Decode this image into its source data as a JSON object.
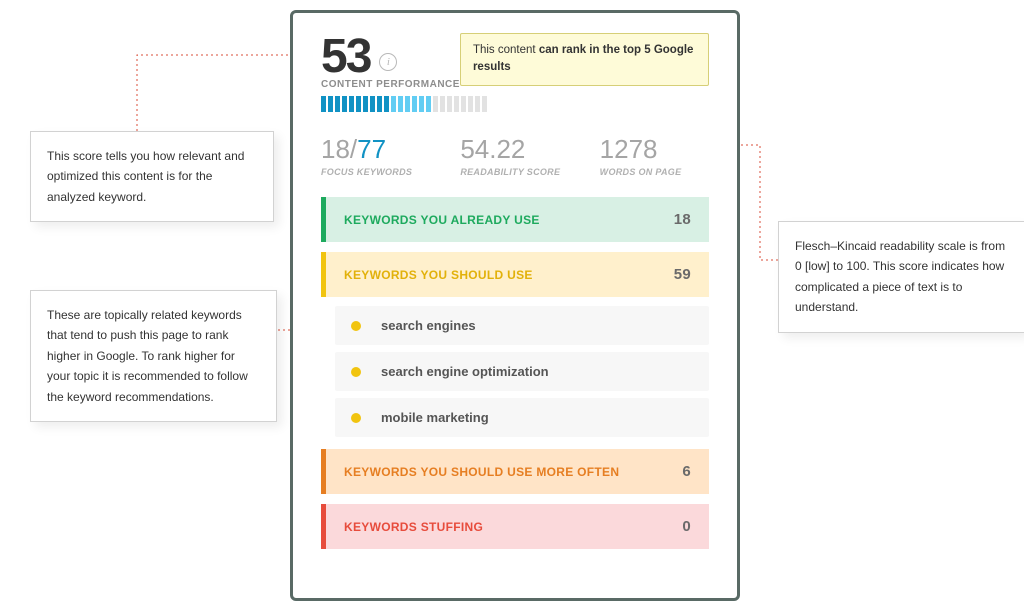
{
  "score": {
    "value": "53",
    "label": "CONTENT PERFORMANCE"
  },
  "rank_tooltip": {
    "prefix": "This content",
    "bold": "can rank in the top 5 Google results"
  },
  "progress": {
    "dark": 10,
    "light": 6,
    "off": 8
  },
  "stats": {
    "focus_keywords": {
      "current": "18",
      "sep": "/",
      "total": "77",
      "label": "FOCUS KEYWORDS"
    },
    "readability": {
      "value": "54.22",
      "label": "READABILITY SCORE"
    },
    "words": {
      "value": "1278",
      "label": "WORDS ON PAGE"
    }
  },
  "sections": {
    "already": {
      "title": "KEYWORDS YOU ALREADY USE",
      "count": "18"
    },
    "should": {
      "title": "KEYWORDS YOU SHOULD USE",
      "count": "59",
      "items": [
        "search engines",
        "search engine optimization",
        "mobile marketing"
      ]
    },
    "more": {
      "title": "KEYWORDS YOU SHOULD USE MORE OFTEN",
      "count": "6"
    },
    "stuffing": {
      "title": "KEYWORDS STUFFING",
      "count": "0"
    }
  },
  "annotations": {
    "a1": "This score tells you how relevant and optimized this content is for the analyzed keyword.",
    "a2": "These are topically related keywords that tend to push this page to rank higher in Google. To rank higher for your topic it is recommended to follow the keyword recommendations.",
    "a3": "Flesch–Kincaid readability scale is from 0 [low] to 100. This score indicates how complicated a piece of text is to understand."
  }
}
